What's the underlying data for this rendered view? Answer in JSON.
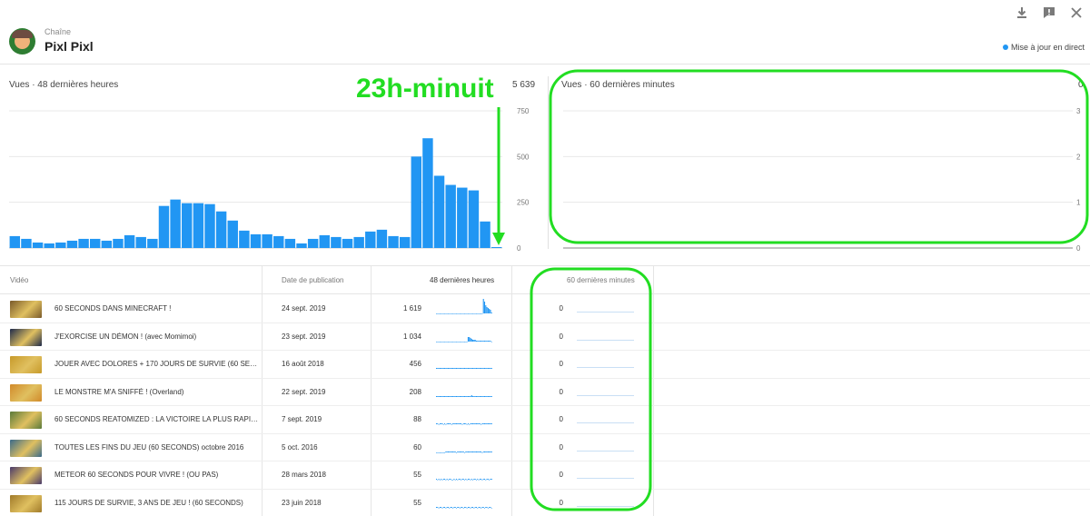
{
  "header": {
    "channel_type": "Chaîne",
    "channel_name": "Pixl Pixl",
    "live_label": "Mise à jour en direct",
    "icons": [
      "download-icon",
      "feedback-icon",
      "close-icon"
    ]
  },
  "chart48": {
    "title": "Vues · 48 dernières heures",
    "total": "5 639"
  },
  "chart60": {
    "title": "Vues · 60 dernières minutes",
    "total": "0"
  },
  "annotation": {
    "text": "23h-minuit",
    "color": "#22dd22"
  },
  "chart_data": [
    {
      "type": "bar",
      "title": "Vues · 48 dernières heures",
      "total": "5 639",
      "values": [
        65,
        50,
        30,
        25,
        30,
        40,
        50,
        50,
        40,
        50,
        70,
        60,
        50,
        230,
        265,
        245,
        245,
        240,
        200,
        150,
        95,
        75,
        75,
        65,
        50,
        25,
        50,
        70,
        60,
        50,
        60,
        90,
        100,
        65,
        60,
        500,
        600,
        395,
        345,
        330,
        315,
        145,
        5
      ],
      "ylim": [
        0,
        750
      ],
      "yticks": [
        "750",
        "500",
        "250",
        "0"
      ],
      "color": "#2196f3",
      "grid": true
    },
    {
      "type": "bar",
      "title": "Vues · 60 dernières minutes",
      "total": "0",
      "values": [],
      "ylim": [
        0,
        3
      ],
      "yticks": [
        "3",
        "2",
        "1",
        "0"
      ],
      "color": "#2196f3",
      "grid": true
    }
  ],
  "table": {
    "headers": {
      "video": "Vidéo",
      "date": "Date de publication",
      "views48": "48 dernières heures",
      "views60": "60 dernières minutes"
    },
    "rows": [
      {
        "title": "60 SECONDS DANS MINECRAFT !",
        "date": "24 sept. 2019",
        "views48": "1 619",
        "views60": "0",
        "thumb_color": "#7a5a2a",
        "spark": [
          0,
          0,
          0,
          0,
          0,
          0,
          0,
          0,
          0,
          0,
          0,
          0,
          0,
          0,
          0,
          0,
          0,
          0,
          0,
          0,
          0,
          0,
          0,
          0,
          0,
          0,
          0,
          0,
          0,
          0,
          0,
          0,
          0,
          0,
          0,
          0,
          0,
          0,
          0,
          0,
          16,
          13,
          9,
          7,
          6,
          5,
          4,
          1
        ]
      },
      {
        "title": "J'EXORCISE UN DÉMON ! (avec Momimoi)",
        "date": "23 sept. 2019",
        "views48": "1 034",
        "views60": "0",
        "thumb_color": "#1e2a4a",
        "spark": [
          0,
          0,
          0,
          0,
          0,
          0,
          0,
          0,
          0,
          0,
          0,
          0,
          0,
          0,
          0,
          0,
          0,
          0,
          0,
          0,
          0,
          0,
          0,
          0,
          0,
          0,
          0,
          5,
          5,
          4,
          3,
          2,
          2,
          2,
          1,
          1,
          1,
          1,
          1,
          1,
          1,
          1,
          1,
          1,
          1,
          1,
          1,
          0
        ]
      },
      {
        "title": "JOUER AVEC DOLORES + 170 JOURS DE SURVIE (60 SECONDS)",
        "date": "16 août 2018",
        "views48": "456",
        "views60": "0",
        "thumb_color": "#c79a2a",
        "spark": [
          1,
          1,
          1,
          1,
          1,
          1,
          1,
          1,
          1,
          1,
          1,
          1,
          1,
          1,
          1,
          1,
          1,
          1,
          1,
          1,
          1,
          1,
          1,
          1,
          1,
          1,
          1,
          1,
          1,
          1,
          1,
          1,
          1,
          1,
          1,
          1,
          1,
          1,
          1,
          1,
          1,
          1,
          1,
          1,
          1,
          1,
          1,
          1
        ]
      },
      {
        "title": "LE MONSTRE M'A SNIFFÉ ! (Overland)",
        "date": "22 sept. 2019",
        "views48": "208",
        "views60": "0",
        "thumb_color": "#d18a2a",
        "spark": [
          1,
          1,
          1,
          1,
          1,
          1,
          1,
          1,
          1,
          1,
          1,
          1,
          1,
          1,
          1,
          1,
          1,
          1,
          1,
          1,
          1,
          1,
          1,
          1,
          1,
          1,
          1,
          1,
          1,
          1,
          2,
          1,
          1,
          1,
          1,
          1,
          1,
          1,
          1,
          1,
          1,
          1,
          1,
          1,
          1,
          1,
          1,
          1
        ]
      },
      {
        "title": "60 SECONDS REATOMIZED : LA VICTOIRE LA PLUS RAPIDE DU MONDE",
        "date": "7 sept. 2019",
        "views48": "88",
        "views60": "0",
        "thumb_color": "#5a7a3a",
        "spark": [
          1,
          1,
          0,
          1,
          1,
          1,
          0,
          1,
          0,
          1,
          1,
          1,
          1,
          0,
          1,
          1,
          1,
          1,
          1,
          1,
          1,
          1,
          0,
          1,
          1,
          1,
          0,
          1,
          0,
          1,
          1,
          1,
          1,
          1,
          1,
          1,
          1,
          1,
          0,
          1,
          1,
          1,
          1,
          1,
          1,
          1,
          1,
          1
        ]
      },
      {
        "title": "TOUTES LES FINS DU JEU (60 SECONDS) octobre 2016",
        "date": "5 oct. 2016",
        "views48": "60",
        "views60": "0",
        "thumb_color": "#3a6a8a",
        "spark": [
          0,
          0,
          0,
          0,
          0,
          0,
          0,
          0,
          1,
          1,
          1,
          1,
          1,
          1,
          1,
          1,
          1,
          0,
          1,
          1,
          1,
          1,
          1,
          1,
          0,
          1,
          1,
          1,
          1,
          1,
          1,
          1,
          1,
          1,
          1,
          1,
          1,
          1,
          1,
          0,
          1,
          1,
          1,
          1,
          1,
          1,
          1,
          1
        ]
      },
      {
        "title": "METEOR 60 SECONDS POUR VIVRE ! (OU PAS)",
        "date": "28 mars 2018",
        "views48": "55",
        "views60": "0",
        "thumb_color": "#4a3a6a",
        "spark": [
          1,
          0,
          1,
          0,
          1,
          0,
          1,
          1,
          0,
          1,
          0,
          1,
          1,
          0,
          0,
          1,
          0,
          1,
          0,
          1,
          1,
          0,
          1,
          1,
          0,
          1,
          0,
          1,
          1,
          0,
          1,
          0,
          1,
          1,
          0,
          1,
          0,
          1,
          1,
          0,
          1,
          1,
          0,
          1,
          1,
          0,
          1,
          1
        ]
      },
      {
        "title": "115 JOURS DE SURVIE, 3 ANS DE JEU ! (60 SECONDS)",
        "date": "23 juin 2018",
        "views48": "55",
        "views60": "0",
        "thumb_color": "#a07a2a",
        "spark": [
          1,
          1,
          0,
          1,
          1,
          0,
          1,
          1,
          0,
          1,
          1,
          0,
          1,
          1,
          0,
          1,
          1,
          0,
          1,
          1,
          0,
          1,
          1,
          0,
          1,
          1,
          0,
          1,
          1,
          0,
          1,
          1,
          0,
          1,
          1,
          0,
          1,
          1,
          0,
          1,
          1,
          0,
          1,
          1,
          0,
          1,
          1,
          0
        ]
      }
    ]
  }
}
